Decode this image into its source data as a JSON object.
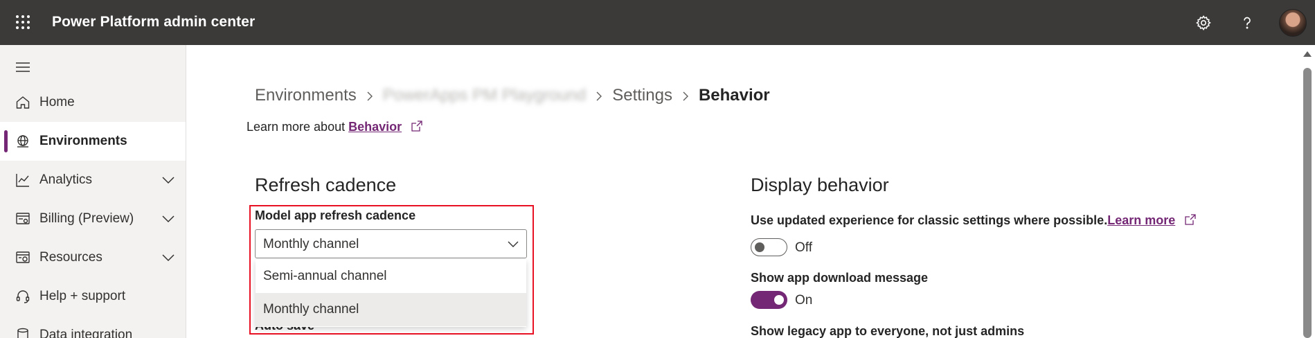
{
  "header": {
    "app_title": "Power Platform admin center",
    "icons": [
      "waffle-icon",
      "gear-icon",
      "help-icon",
      "avatar"
    ],
    "bg_color": "#3b3a39"
  },
  "sidebar": {
    "items": [
      {
        "label": "Home",
        "icon": "home-icon",
        "expandable": false,
        "active": false
      },
      {
        "label": "Environments",
        "icon": "globe-icon",
        "expandable": false,
        "active": true
      },
      {
        "label": "Analytics",
        "icon": "chart-icon",
        "expandable": true,
        "active": false
      },
      {
        "label": "Billing (Preview)",
        "icon": "billing-icon",
        "expandable": true,
        "active": false
      },
      {
        "label": "Resources",
        "icon": "resources-icon",
        "expandable": true,
        "active": false
      },
      {
        "label": "Help + support",
        "icon": "headset-icon",
        "expandable": false,
        "active": false
      },
      {
        "label": "Data integration",
        "icon": "database-icon",
        "expandable": false,
        "active": false
      }
    ],
    "accent_color": "#742774"
  },
  "breadcrumb": {
    "items": [
      "Environments",
      "PowerApps PM Playground",
      "Settings",
      "Behavior"
    ]
  },
  "learn_more": {
    "prefix": "Learn more about ",
    "link": "Behavior"
  },
  "refresh": {
    "title": "Refresh cadence",
    "field_label": "Model app refresh cadence",
    "selected": "Monthly channel",
    "options": [
      "Semi-annual channel",
      "Monthly channel"
    ],
    "next_label": "Auto save"
  },
  "display": {
    "title": "Display behavior",
    "settings": [
      {
        "text": "Use updated experience for classic settings where possible.",
        "link": "Learn more",
        "state": "Off",
        "on": false
      },
      {
        "text": "Show app download message",
        "state": "On",
        "on": true
      },
      {
        "text": "Show legacy app to everyone, not just admins"
      }
    ]
  }
}
